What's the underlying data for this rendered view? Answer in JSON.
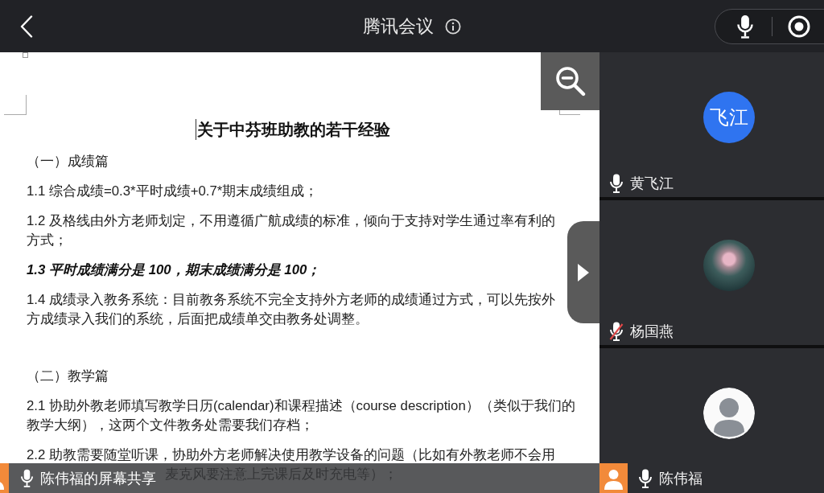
{
  "header": {
    "title": "腾讯会议"
  },
  "document": {
    "title": "关于中芬班助教的若干经验",
    "blocks": [
      {
        "kind": "section",
        "lines": [
          "（一）成绩篇"
        ]
      },
      {
        "kind": "paragraph",
        "lines": [
          "1.1 综合成绩=0.3*平时成绩+0.7*期末成绩组成；"
        ]
      },
      {
        "kind": "paragraph",
        "lines": [
          "1.2 及格线由外方老师划定，不用遵循广航成绩的标准，倾向于支持对学生通过率有利的",
          "方式；"
        ]
      },
      {
        "kind": "emphasis",
        "lines": [
          "1.3 平时成绩满分是 100，期末成绩满分是 100；"
        ]
      },
      {
        "kind": "paragraph",
        "lines": [
          "1.4 成绩录入教务系统：目前教务系统不完全支持外方老师的成绩通过方式，可以先按外",
          "方成绩录入我们的系统，后面把成绩单交由教务处调整。"
        ]
      },
      {
        "kind": "section",
        "lines": [
          "（二）教学篇"
        ]
      },
      {
        "kind": "paragraph",
        "lines": [
          "2.1 协助外教老师填写教学日历(calendar)和课程描述（course description）（类似于我们的",
          "教学大纲），这两个文件教务处需要我们存档；"
        ]
      },
      {
        "kind": "paragraph",
        "lines": [
          "2.2 助教需要随堂听课，协助外方老师解决使用教学设备的问题（比如有外教老师不会用"
        ],
        "covered_line": "麦克风要注意上完课后及时充电等）；"
      }
    ]
  },
  "share_bar": {
    "label": "陈伟福的屏幕共享",
    "badge": true,
    "muted": false
  },
  "participants": [
    {
      "name": "黄飞江",
      "avatar": {
        "kind": "initials",
        "text": "飞江"
      },
      "muted": false,
      "badge": false
    },
    {
      "name": "杨国燕",
      "avatar": {
        "kind": "photo"
      },
      "muted": true,
      "badge": false
    },
    {
      "name": "陈伟福",
      "avatar": {
        "kind": "portrait"
      },
      "muted": false,
      "badge": true
    }
  ]
}
